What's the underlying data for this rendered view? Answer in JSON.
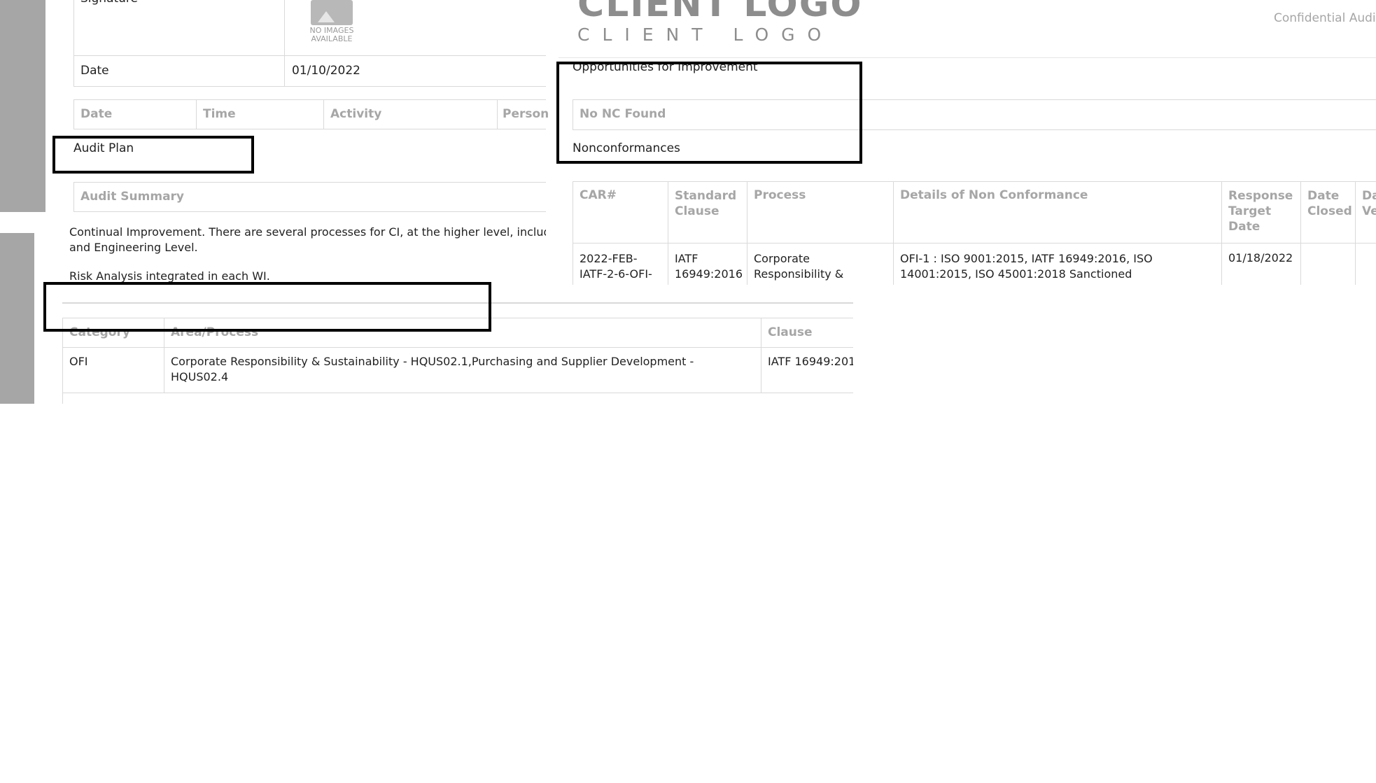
{
  "top_left_form": {
    "signature_label": "Signature",
    "no_images_text": "NO IMAGES AVAILABLE",
    "date_label": "Date",
    "date_value": "01/10/2022"
  },
  "audit_plan_table": {
    "columns": [
      "Date",
      "Time",
      "Activity",
      "Person"
    ]
  },
  "sections": {
    "audit_plan": "Audit Plan",
    "audit_summary": "Audit Summary",
    "opportunities": "Opportunities for Improvement",
    "no_nc_found": "No NC Found",
    "nonconformances": "Nonconformances"
  },
  "header": {
    "logo_big": "CLIENT LOGO",
    "logo_small": "CLIENT LOGO",
    "confidential": "Confidential Audit"
  },
  "summary_text": {
    "line1": "Continual Improvement. There are several processes for CI, at the higher level, including QM",
    "line2": "and Engineering Level.",
    "line3": "Risk Analysis integrated in each WI."
  },
  "nc_table": {
    "columns": [
      "CAR#",
      "Standard Clause",
      "Process",
      "Details of Non Conformance",
      "Response Target Date",
      "Date Closed",
      "Date Ve"
    ],
    "rows": [
      {
        "car": "2022-FEB-IATF-2-6-OFI-",
        "clause": "IATF 16949:2016",
        "process": "Corporate Responsibility &",
        "details": "OFI-1 : ISO 9001:2015, IATF 16949:2016, ISO 14001:2015, ISO 45001:2018 Sanctioned",
        "target_date": "01/18/2022",
        "closed": "",
        "verified": ""
      }
    ]
  },
  "findings_table": {
    "columns": [
      "Category",
      "Area/Process",
      "Clause"
    ],
    "rows": [
      {
        "category": "OFI",
        "area_line1": "Corporate Responsibility & Sustainability - HQUS02.1,Purchasing and Supplier Development -",
        "area_line2": "HQUS02.4",
        "clause": "IATF 16949:201"
      }
    ]
  }
}
